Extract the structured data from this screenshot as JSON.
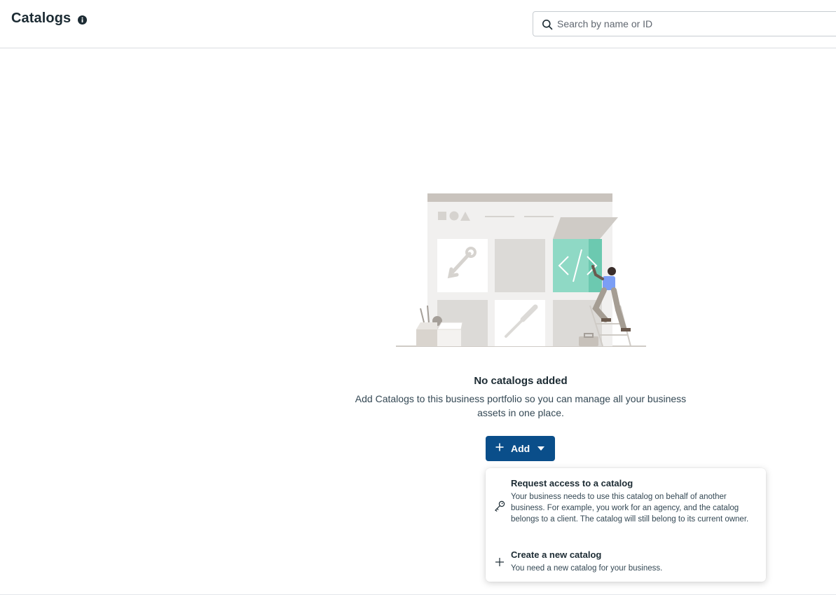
{
  "header": {
    "title": "Catalogs",
    "search_placeholder": "Search by name or ID"
  },
  "empty_state": {
    "title": "No catalogs added",
    "description": "Add Catalogs to this business portfolio so you can manage all your business assets in one place."
  },
  "add_button": {
    "label": "Add"
  },
  "dropdown": {
    "items": [
      {
        "title": "Request access to a catalog",
        "description": "Your business needs to use this catalog on behalf of another business. For example, you work for an agency, and the catalog belongs to a client. The catalog will still belong to its current owner.",
        "icon": "key-icon"
      },
      {
        "title": "Create a new catalog",
        "description": "You need a new catalog for your business.",
        "icon": "plus-icon"
      }
    ]
  },
  "colors": {
    "primary_button": "#0a4e8a",
    "text_primary": "#1c2b33",
    "illustration_teal": "#8fd9c5"
  }
}
